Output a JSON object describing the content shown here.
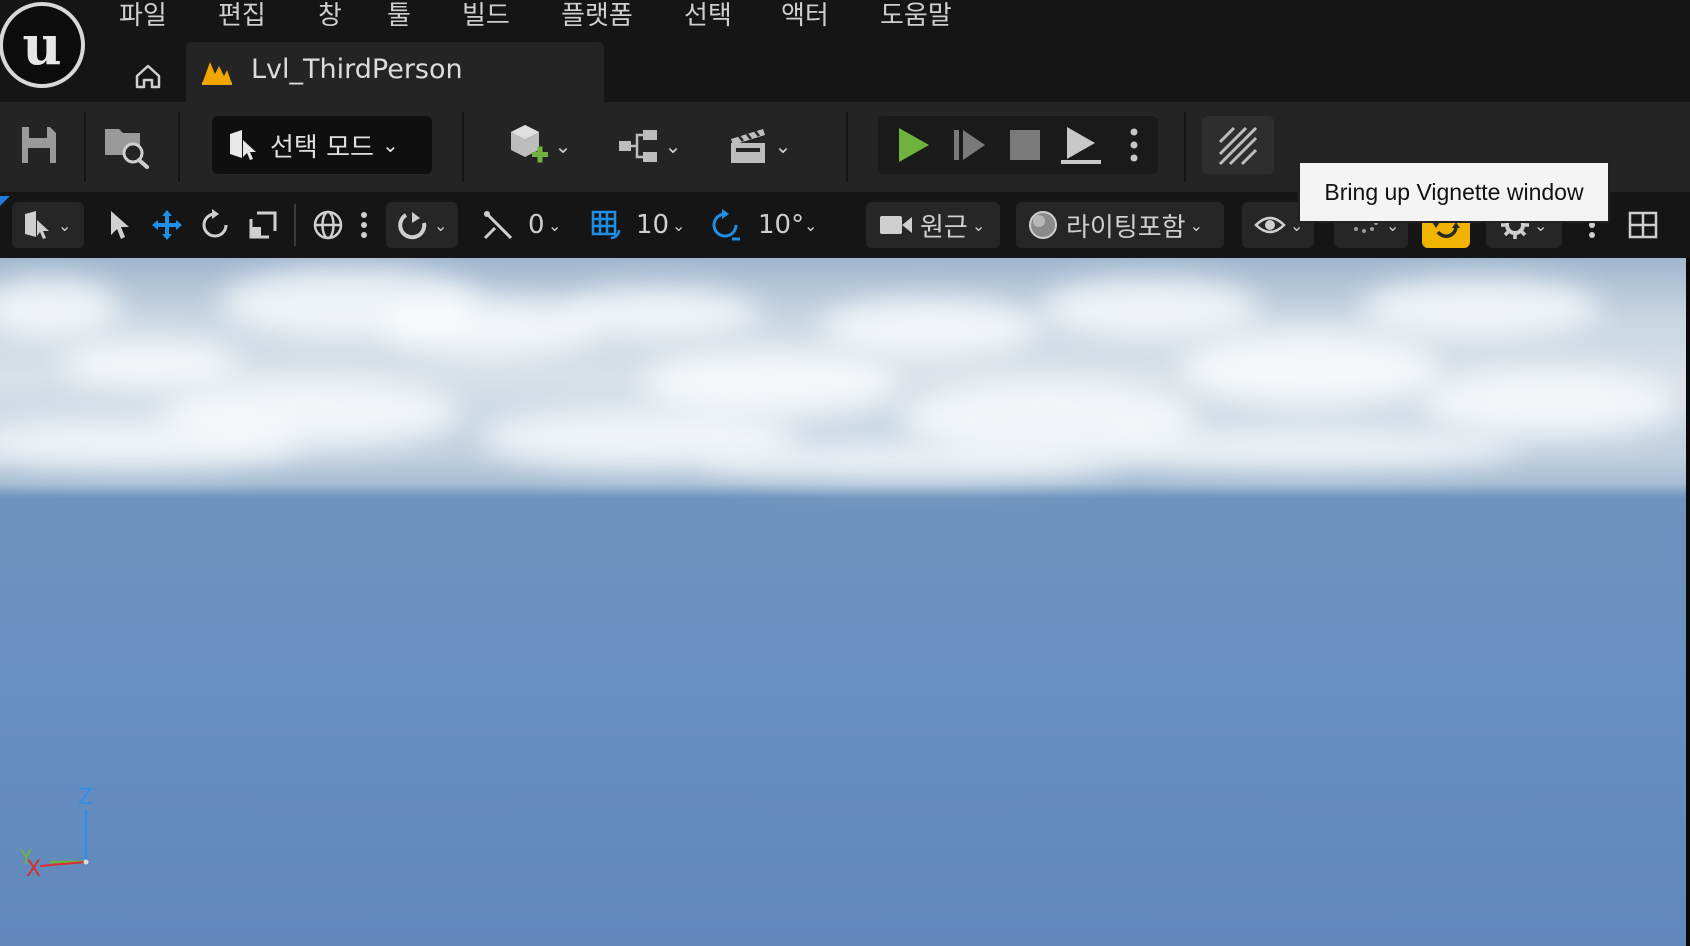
{
  "menu": {
    "items": [
      "파일",
      "편집",
      "창",
      "툴",
      "빌드",
      "플랫폼",
      "선택",
      "액터",
      "도움말"
    ]
  },
  "tabs": {
    "level_name": "Lvl_ThirdPerson"
  },
  "toolbar": {
    "mode_label": "선택 모드"
  },
  "viewport_toolbar": {
    "angle_snap_value": "0",
    "grid_snap_value": "10",
    "rotation_snap_value": "10°",
    "view_mode_label": "원근",
    "lighting_label": "라이팅포함"
  },
  "tooltip": {
    "text": "Bring up Vignette window"
  },
  "axes": {
    "z": "Z",
    "x": "X",
    "y": "Y"
  },
  "colors": {
    "play_green": "#6fb23c",
    "accent_blue": "#1f8fe6",
    "realtime_yellow": "#f0b400"
  }
}
